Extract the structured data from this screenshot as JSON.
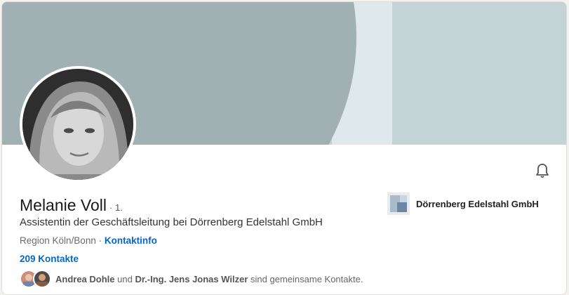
{
  "profile": {
    "name": "Melanie Voll",
    "connection_degree": "· 1.",
    "headline": "Assistentin der Geschäftsleitung bei Dörrenberg Edelstahl GmbH",
    "location": "Region Köln/Bonn",
    "location_separator": " · ",
    "contact_info_link": "Kontaktinfo",
    "connections": "209 Kontakte"
  },
  "company": {
    "name": "Dörrenberg Edelstahl GmbH"
  },
  "mutual": {
    "person1": "Andrea Dohle",
    "conjunction": " und ",
    "person2": "Dr.-Ing. Jens Jonas Wilzer",
    "suffix": " sind gemeinsame Kontakte."
  },
  "icons": {
    "notification": "bell-icon"
  },
  "colors": {
    "link": "#0a66c2",
    "banner_light": "#c3d3d6",
    "banner_dark": "#a0b0b3"
  }
}
